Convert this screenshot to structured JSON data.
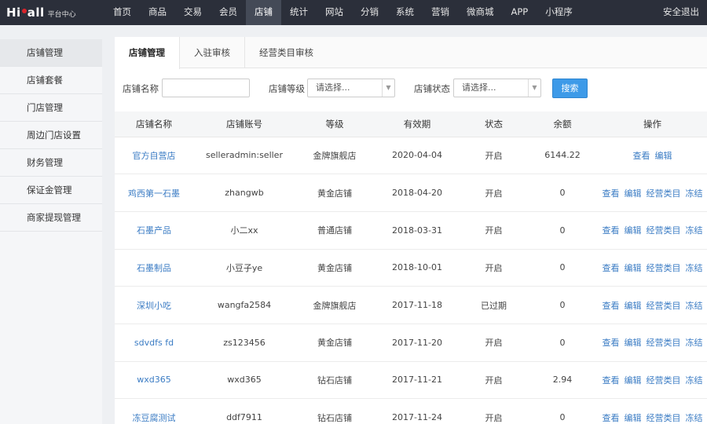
{
  "logo": {
    "main": "Hi",
    "main2": "all",
    "sub": "平台中心"
  },
  "nav": [
    {
      "label": "首页"
    },
    {
      "label": "商品"
    },
    {
      "label": "交易"
    },
    {
      "label": "会员"
    },
    {
      "label": "店铺",
      "active": true
    },
    {
      "label": "统计"
    },
    {
      "label": "网站"
    },
    {
      "label": "分销"
    },
    {
      "label": "系统"
    },
    {
      "label": "营销"
    },
    {
      "label": "微商城"
    },
    {
      "label": "APP"
    },
    {
      "label": "小程序"
    }
  ],
  "logout_label": "安全退出",
  "sidebar": [
    {
      "label": "店铺管理",
      "active": true
    },
    {
      "label": "店铺套餐"
    },
    {
      "label": "门店管理"
    },
    {
      "label": "周边门店设置"
    },
    {
      "label": "财务管理"
    },
    {
      "label": "保证金管理"
    },
    {
      "label": "商家提现管理"
    }
  ],
  "tabs": [
    {
      "label": "店铺管理",
      "active": true
    },
    {
      "label": "入驻审核"
    },
    {
      "label": "经营类目审核"
    }
  ],
  "filter": {
    "name_label": "店铺名称",
    "name_value": "",
    "grade_label": "店铺等级",
    "grade_value": "请选择...",
    "status_label": "店铺状态",
    "status_value": "请选择...",
    "search_label": "搜索"
  },
  "table": {
    "headers": [
      "店铺名称",
      "店铺账号",
      "等级",
      "有效期",
      "状态",
      "余额",
      "操作"
    ],
    "rows": [
      {
        "name": "官方自营店",
        "account": "selleradmin:seller",
        "grade": "金牌旗舰店",
        "expire": "2020-04-04",
        "status": "开启",
        "balance": "6144.22",
        "ops": [
          "查看",
          "编辑"
        ]
      },
      {
        "name": "鸡西第一石墨",
        "account": "zhangwb",
        "grade": "黄金店铺",
        "expire": "2018-04-20",
        "status": "开启",
        "balance": "0",
        "ops": [
          "查看",
          "编辑",
          "经营类目",
          "冻结"
        ]
      },
      {
        "name": "石墨产品",
        "account": "小二xx",
        "grade": "普通店铺",
        "expire": "2018-03-31",
        "status": "开启",
        "balance": "0",
        "ops": [
          "查看",
          "编辑",
          "经营类目",
          "冻结"
        ]
      },
      {
        "name": "石墨制品",
        "account": "小豆子ye",
        "grade": "黄金店铺",
        "expire": "2018-10-01",
        "status": "开启",
        "balance": "0",
        "ops": [
          "查看",
          "编辑",
          "经营类目",
          "冻结"
        ]
      },
      {
        "name": "深圳小吃",
        "account": "wangfa2584",
        "grade": "金牌旗舰店",
        "expire": "2017-11-18",
        "status": "已过期",
        "balance": "0",
        "ops": [
          "查看",
          "编辑",
          "经营类目",
          "冻结"
        ]
      },
      {
        "name": "sdvdfs fd",
        "account": "zs123456",
        "grade": "黄金店铺",
        "expire": "2017-11-20",
        "status": "开启",
        "balance": "0",
        "ops": [
          "查看",
          "编辑",
          "经营类目",
          "冻结"
        ]
      },
      {
        "name": "wxd365",
        "account": "wxd365",
        "grade": "钻石店铺",
        "expire": "2017-11-21",
        "status": "开启",
        "balance": "2.94",
        "ops": [
          "查看",
          "编辑",
          "经营类目",
          "冻结"
        ]
      },
      {
        "name": "冻豆腐测试",
        "account": "ddf7911",
        "grade": "钻石店铺",
        "expire": "2017-11-24",
        "status": "开启",
        "balance": "0",
        "ops": [
          "查看",
          "编辑",
          "经营类目",
          "冻结"
        ]
      }
    ]
  },
  "colors": {
    "topbar": "#2b2f3a",
    "accent": "#3d9ae8",
    "link": "#3b7cc4"
  }
}
